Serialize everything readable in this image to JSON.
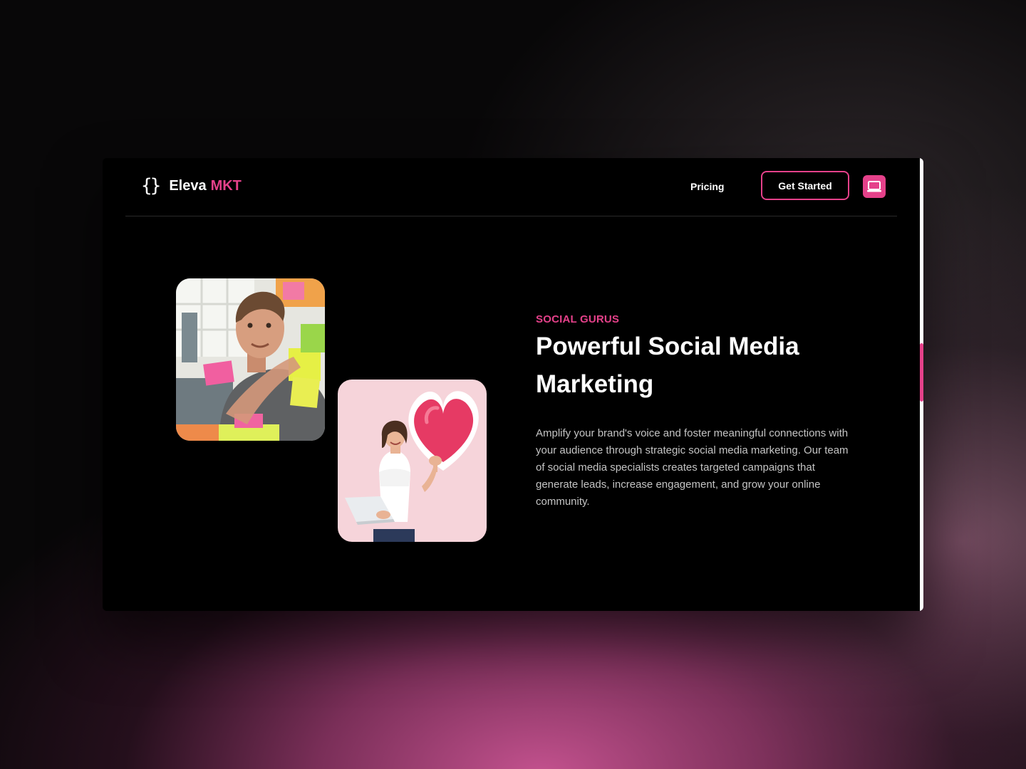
{
  "brand": {
    "name": "Eleva",
    "accent": "MKT",
    "icon": "curly-braces-icon"
  },
  "nav": {
    "links": [
      "Pricing"
    ],
    "cta_label": "Get Started",
    "device_icon": "laptop-icon"
  },
  "hero": {
    "eyebrow": "SOCIAL GURUS",
    "title": "Powerful Social Media Marketing",
    "description": "Amplify your brand's voice and foster meaningful connections with your audience through strategic social media marketing. Our team of social media specialists creates targeted campaigns that generate leads, increase engagement, and grow your online community.",
    "images": [
      "man-with-sticky-notes-photo",
      "woman-with-heart-and-laptop-photo"
    ]
  },
  "colors": {
    "accent": "#e5418a",
    "background": "#000000",
    "text": "#ffffff",
    "muted": "#c4c4c4"
  }
}
